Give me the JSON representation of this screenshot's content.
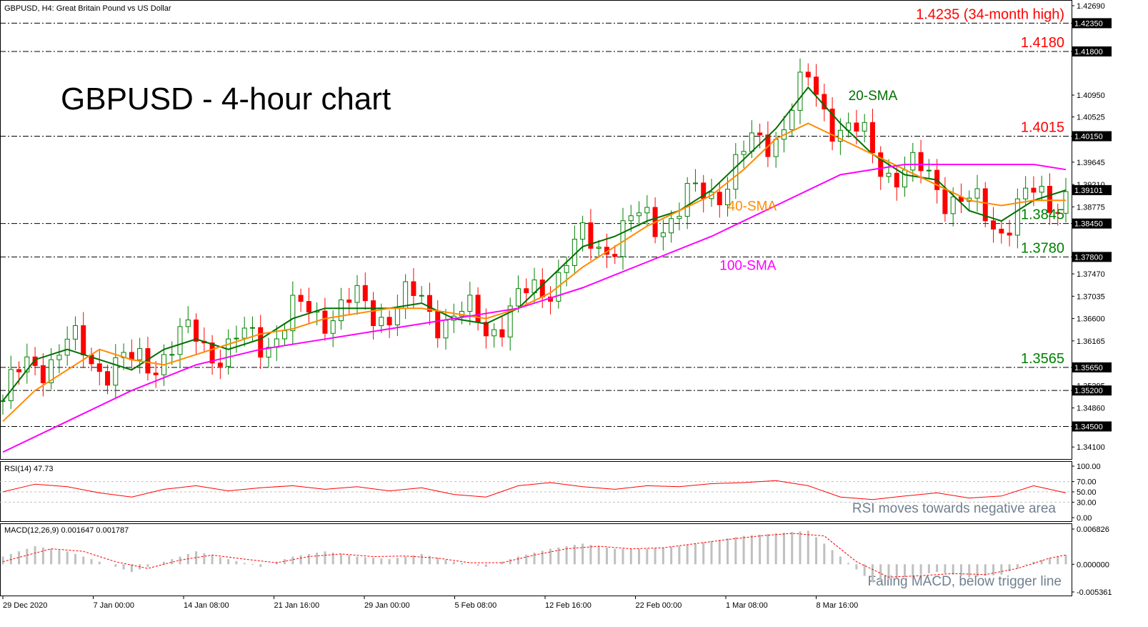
{
  "header": {
    "symbol_line": "GBPUSD, H4:  Great Britain Pound vs US Dollar"
  },
  "chart_data": [
    {
      "type": "line",
      "title": "GBPUSD - 4-hour chart",
      "x_labels": [
        "29 Dec 2020",
        "7 Jan 00:00",
        "14 Jan 08:00",
        "21 Jan 16:00",
        "29 Jan 00:00",
        "5 Feb 08:00",
        "12 Feb 16:00",
        "22 Feb 00:00",
        "1 Mar 08:00",
        "8 Mar 16:00"
      ],
      "y_ticks": [
        "1.42690",
        "1.42350",
        "1.41800",
        "1.40950",
        "1.40525",
        "1.40150",
        "1.39645",
        "1.39210",
        "1.39101",
        "1.38775",
        "1.38450",
        "1.37800",
        "1.37470",
        "1.37035",
        "1.36600",
        "1.36165",
        "1.35650",
        "1.35295",
        "1.35200",
        "1.34860",
        "1.34500",
        "1.34100"
      ],
      "ylim": [
        1.3395,
        1.4269
      ],
      "price_marker": "1.39101",
      "levels": [
        {
          "value": 1.4235,
          "axis_label": "1.42350",
          "label": "1.4235 (34-month high)",
          "color": "#ff0000"
        },
        {
          "value": 1.418,
          "axis_label": "1.41800",
          "label": "1.4180",
          "color": "#ff0000"
        },
        {
          "value": 1.4015,
          "axis_label": "1.40150",
          "label": "1.4015",
          "color": "#ff0000"
        },
        {
          "value": 1.3845,
          "axis_label": "1.38450",
          "label": "1.3845",
          "color": "#008000"
        },
        {
          "value": 1.378,
          "axis_label": "1.37800",
          "label": "1.3780",
          "color": "#008000"
        },
        {
          "value": 1.3565,
          "axis_label": "1.35650",
          "label": "1.3565",
          "color": "#008000"
        },
        {
          "value": 1.352,
          "axis_label": "1.35200",
          "label": "",
          "color": "#008000"
        },
        {
          "value": 1.345,
          "axis_label": "1.34500",
          "label": "",
          "color": "#008000"
        }
      ],
      "series": [
        {
          "name": "20-SMA",
          "color": "#007000",
          "points": [
            [
              0,
              1.35
            ],
            [
              4,
              1.358
            ],
            [
              8,
              1.36
            ],
            [
              12,
              1.358
            ],
            [
              16,
              1.356
            ],
            [
              20,
              1.36
            ],
            [
              24,
              1.362
            ],
            [
              28,
              1.36
            ],
            [
              32,
              1.362
            ],
            [
              36,
              1.366
            ],
            [
              40,
              1.368
            ],
            [
              44,
              1.368
            ],
            [
              48,
              1.368
            ],
            [
              52,
              1.369
            ],
            [
              56,
              1.366
            ],
            [
              60,
              1.365
            ],
            [
              64,
              1.368
            ],
            [
              68,
              1.374
            ],
            [
              72,
              1.38
            ],
            [
              76,
              1.382
            ],
            [
              80,
              1.385
            ],
            [
              84,
              1.387
            ],
            [
              88,
              1.391
            ],
            [
              92,
              1.397
            ],
            [
              96,
              1.403
            ],
            [
              100,
              1.411
            ],
            [
              104,
              1.404
            ],
            [
              108,
              1.398
            ],
            [
              112,
              1.394
            ],
            [
              116,
              1.393
            ],
            [
              120,
              1.387
            ],
            [
              124,
              1.385
            ],
            [
              128,
              1.389
            ],
            [
              132,
              1.391
            ]
          ]
        },
        {
          "name": "40-SMA",
          "color": "#ff8c00",
          "points": [
            [
              0,
              1.346
            ],
            [
              4,
              1.352
            ],
            [
              8,
              1.356
            ],
            [
              12,
              1.36
            ],
            [
              16,
              1.358
            ],
            [
              20,
              1.357
            ],
            [
              24,
              1.359
            ],
            [
              28,
              1.361
            ],
            [
              32,
              1.363
            ],
            [
              36,
              1.364
            ],
            [
              40,
              1.366
            ],
            [
              44,
              1.367
            ],
            [
              48,
              1.368
            ],
            [
              52,
              1.368
            ],
            [
              56,
              1.367
            ],
            [
              60,
              1.366
            ],
            [
              64,
              1.368
            ],
            [
              68,
              1.371
            ],
            [
              72,
              1.376
            ],
            [
              76,
              1.38
            ],
            [
              80,
              1.384
            ],
            [
              84,
              1.387
            ],
            [
              88,
              1.39
            ],
            [
              92,
              1.395
            ],
            [
              96,
              1.401
            ],
            [
              100,
              1.404
            ],
            [
              104,
              1.401
            ],
            [
              108,
              1.398
            ],
            [
              112,
              1.395
            ],
            [
              116,
              1.392
            ],
            [
              120,
              1.389
            ],
            [
              124,
              1.388
            ],
            [
              128,
              1.389
            ],
            [
              132,
              1.389
            ]
          ]
        },
        {
          "name": "100-SMA",
          "color": "#ff00ff",
          "points": [
            [
              0,
              1.34
            ],
            [
              8,
              1.346
            ],
            [
              16,
              1.352
            ],
            [
              24,
              1.357
            ],
            [
              32,
              1.36
            ],
            [
              40,
              1.362
            ],
            [
              48,
              1.364
            ],
            [
              56,
              1.366
            ],
            [
              64,
              1.368
            ],
            [
              72,
              1.372
            ],
            [
              80,
              1.377
            ],
            [
              88,
              1.382
            ],
            [
              96,
              1.388
            ],
            [
              104,
              1.394
            ],
            [
              112,
              1.396
            ],
            [
              120,
              1.396
            ],
            [
              128,
              1.396
            ],
            [
              132,
              1.395
            ]
          ]
        }
      ],
      "annotations": [
        {
          "text": "20-SMA",
          "color": "#007000",
          "x": 105,
          "y": 1.4085
        },
        {
          "text": "40-SMA",
          "color": "#ff8c00",
          "x": 90,
          "y": 1.387
        },
        {
          "text": "100-SMA",
          "color": "#ff00ff",
          "x": 89,
          "y": 1.3755
        }
      ]
    },
    {
      "type": "line",
      "title": "RSI(14) 47.73",
      "y_ticks": [
        "100.00",
        "70.00",
        "50.00",
        "30.00",
        "0.00"
      ],
      "ylim": [
        0,
        100
      ],
      "annotation": "RSI moves towards negative area",
      "series": [
        {
          "name": "RSI(14)",
          "color": "#ff0000",
          "points": [
            [
              0,
              50
            ],
            [
              4,
              65
            ],
            [
              8,
              60
            ],
            [
              12,
              48
            ],
            [
              16,
              40
            ],
            [
              20,
              55
            ],
            [
              24,
              62
            ],
            [
              28,
              52
            ],
            [
              32,
              58
            ],
            [
              36,
              62
            ],
            [
              40,
              55
            ],
            [
              44,
              60
            ],
            [
              48,
              52
            ],
            [
              52,
              58
            ],
            [
              56,
              45
            ],
            [
              60,
              40
            ],
            [
              64,
              62
            ],
            [
              68,
              68
            ],
            [
              72,
              60
            ],
            [
              76,
              55
            ],
            [
              80,
              62
            ],
            [
              84,
              60
            ],
            [
              88,
              66
            ],
            [
              92,
              68
            ],
            [
              96,
              72
            ],
            [
              100,
              62
            ],
            [
              104,
              40
            ],
            [
              108,
              35
            ],
            [
              112,
              42
            ],
            [
              116,
              48
            ],
            [
              120,
              38
            ],
            [
              124,
              42
            ],
            [
              128,
              62
            ],
            [
              132,
              48
            ]
          ]
        }
      ]
    },
    {
      "type": "bar",
      "title": "MACD(12,26,9) 0.001647 0.001787",
      "y_ticks": [
        "0.006826",
        "0.000000",
        "-0.005361"
      ],
      "ylim": [
        -0.005361,
        0.006826
      ],
      "annotation": "Falling MACD, below trigger line",
      "series": [
        {
          "name": "MACD",
          "color": "#c0c0c0",
          "points": [
            [
              0,
              0.0015
            ],
            [
              4,
              0.0035
            ],
            [
              8,
              0.0025
            ],
            [
              12,
              0.0005
            ],
            [
              16,
              -0.0015
            ],
            [
              20,
              0.0005
            ],
            [
              24,
              0.0025
            ],
            [
              28,
              0.001
            ],
            [
              32,
              -0.0005
            ],
            [
              36,
              0.0015
            ],
            [
              40,
              0.0025
            ],
            [
              44,
              0.0015
            ],
            [
              48,
              0.001
            ],
            [
              52,
              0.002
            ],
            [
              56,
              0.0005
            ],
            [
              60,
              -0.0005
            ],
            [
              64,
              0.0015
            ],
            [
              68,
              0.003
            ],
            [
              72,
              0.004
            ],
            [
              76,
              0.003
            ],
            [
              80,
              0.003
            ],
            [
              84,
              0.0035
            ],
            [
              88,
              0.0045
            ],
            [
              92,
              0.0055
            ],
            [
              96,
              0.006
            ],
            [
              100,
              0.0065
            ],
            [
              104,
              0.0015
            ],
            [
              108,
              -0.0035
            ],
            [
              112,
              -0.0025
            ],
            [
              116,
              -0.0015
            ],
            [
              120,
              -0.0025
            ],
            [
              124,
              -0.002
            ],
            [
              128,
              0.0005
            ],
            [
              132,
              0.0018
            ]
          ]
        },
        {
          "name": "Signal",
          "color": "#ff0000",
          "points": [
            [
              0,
              0.0005
            ],
            [
              6,
              0.003
            ],
            [
              10,
              0.0025
            ],
            [
              14,
              0.0005
            ],
            [
              18,
              -0.0008
            ],
            [
              22,
              0.0008
            ],
            [
              26,
              0.0018
            ],
            [
              30,
              0.001
            ],
            [
              34,
              0.0003
            ],
            [
              38,
              0.0015
            ],
            [
              42,
              0.002
            ],
            [
              46,
              0.0015
            ],
            [
              50,
              0.0016
            ],
            [
              54,
              0.0012
            ],
            [
              58,
              0.0003
            ],
            [
              62,
              0.0003
            ],
            [
              66,
              0.0018
            ],
            [
              70,
              0.003
            ],
            [
              74,
              0.0035
            ],
            [
              78,
              0.003
            ],
            [
              82,
              0.0032
            ],
            [
              86,
              0.004
            ],
            [
              90,
              0.0048
            ],
            [
              94,
              0.0055
            ],
            [
              98,
              0.006
            ],
            [
              102,
              0.0055
            ],
            [
              106,
              0.0005
            ],
            [
              110,
              -0.0025
            ],
            [
              114,
              -0.0022
            ],
            [
              118,
              -0.0018
            ],
            [
              122,
              -0.002
            ],
            [
              126,
              -0.0008
            ],
            [
              130,
              0.0012
            ],
            [
              132,
              0.0018
            ]
          ]
        }
      ]
    }
  ]
}
